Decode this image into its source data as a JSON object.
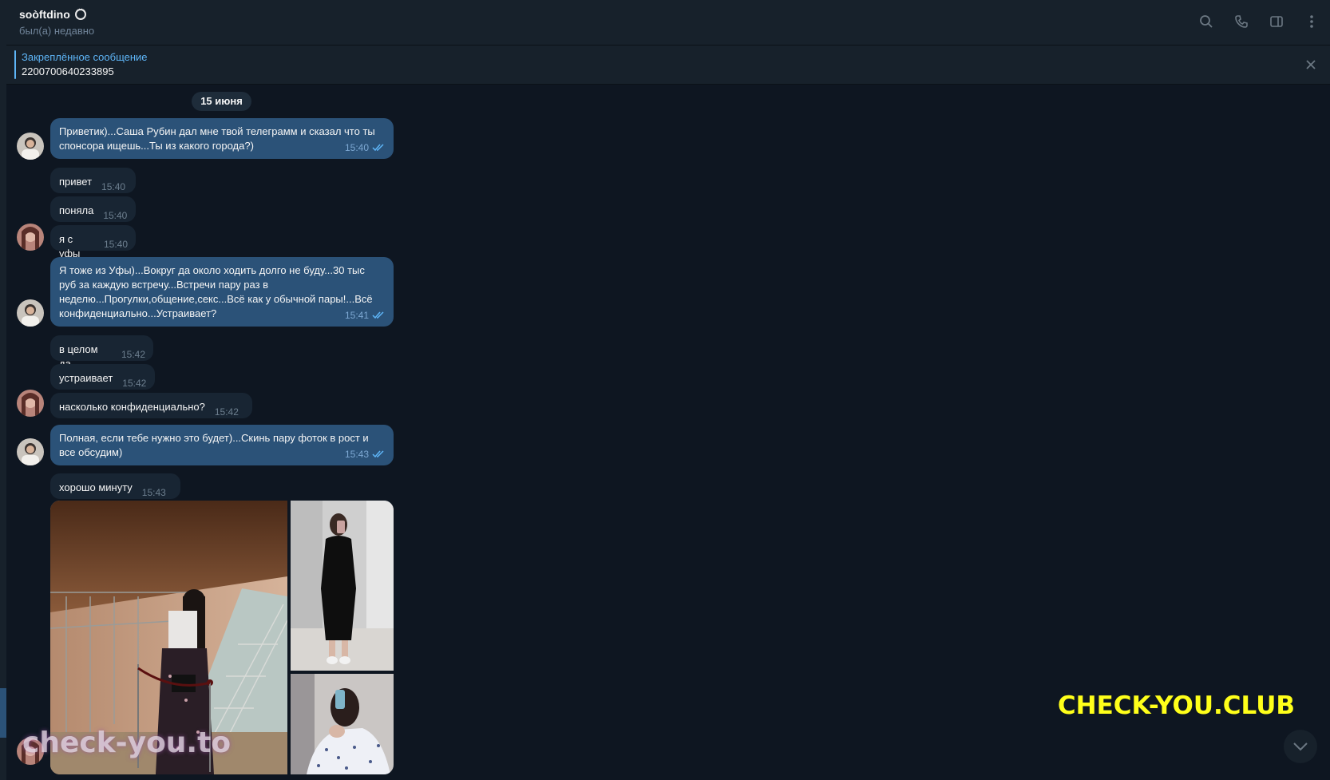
{
  "header": {
    "name": "soòftdino",
    "status": "был(а) недавно",
    "icons": [
      "search-icon",
      "phone-icon",
      "sidebar-toggle-icon",
      "more-vertical-icon"
    ]
  },
  "pinned": {
    "title": "Закреплённое сообщение",
    "text": "2200700640233895"
  },
  "date_separator": "15 июня",
  "messages": [
    {
      "dir": "out",
      "lines": [
        "Приветик)...Саша Рубин дал мне твой телеграмм и сказал что ты",
        "спонсора ищешь...Ты из какого города?)"
      ],
      "time": "15:40"
    },
    {
      "dir": "in",
      "text": "привет",
      "time": "15:40"
    },
    {
      "dir": "in",
      "text": "поняла",
      "time": "15:40"
    },
    {
      "dir": "in",
      "text": "я с уфы",
      "time": "15:40"
    },
    {
      "dir": "out",
      "lines": [
        "Я тоже из Уфы)...Вокруг да около ходить долго не буду...30 тыс",
        "руб за каждую встречу...Встречи пару раз в",
        "неделю...Прогулки,общение,секс...Всё как у обычной пары!...Всё",
        "конфиденциально...Устраивает?"
      ],
      "time": "15:41"
    },
    {
      "dir": "in",
      "text": "в целом да",
      "time": "15:42"
    },
    {
      "dir": "in",
      "text": "устраивает",
      "time": "15:42"
    },
    {
      "dir": "in",
      "text": "насколько конфиденциально?",
      "time": "15:42"
    },
    {
      "dir": "out",
      "lines": [
        "Полная, если тебе нужно это будет)...Скинь пару фоток в рост и",
        "все обсудим)"
      ],
      "time": "15:43"
    },
    {
      "dir": "in",
      "text": "хорошо минуту",
      "time": "15:43"
    }
  ],
  "watermarks": {
    "left": "check-you.to",
    "right": "CHECK-YOU.CLUB"
  },
  "colors": {
    "background": "#0e1621",
    "panel": "#17212b",
    "outgoing_bubble": "#2b5278",
    "incoming_bubble": "#182533",
    "accent": "#5eb5f7",
    "watermark_right": "#ffff1a"
  }
}
